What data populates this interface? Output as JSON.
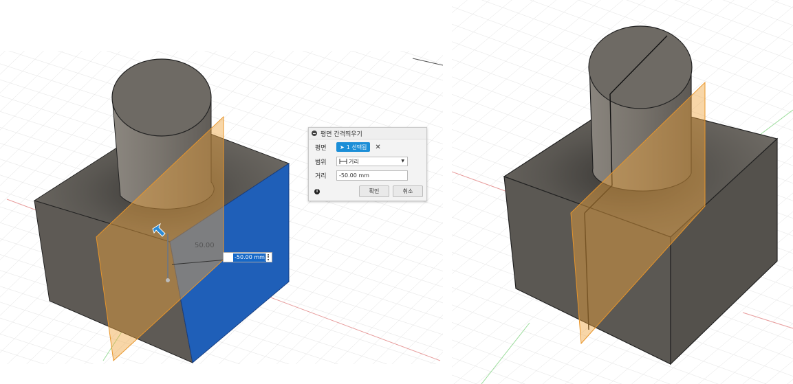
{
  "dialog": {
    "title": "평면 간격띄우기",
    "plane_label": "평면",
    "selection_text": "1 선택됨",
    "extent_label": "범위",
    "extent_value": "거리",
    "distance_label": "거리",
    "distance_value": "-50.00 mm",
    "ok_label": "확인",
    "cancel_label": "취소",
    "selection_color": "#1b8ed7"
  },
  "canvas": {
    "dimension_label": "50.00",
    "input_value": "-50.00 mm"
  },
  "colors": {
    "body_gray": "#6e6b66",
    "plane_orange": "#f0a43c",
    "selected_face_blue": "#1f5fb8",
    "x_axis": "#e07070",
    "y_axis": "#7fd27f"
  },
  "icons": [
    "collapse-icon",
    "cursor-icon",
    "clear-icon",
    "distance-icon",
    "dropdown-arrow-icon",
    "info-icon",
    "drag-arrow-icon",
    "menu-dots-icon"
  ]
}
